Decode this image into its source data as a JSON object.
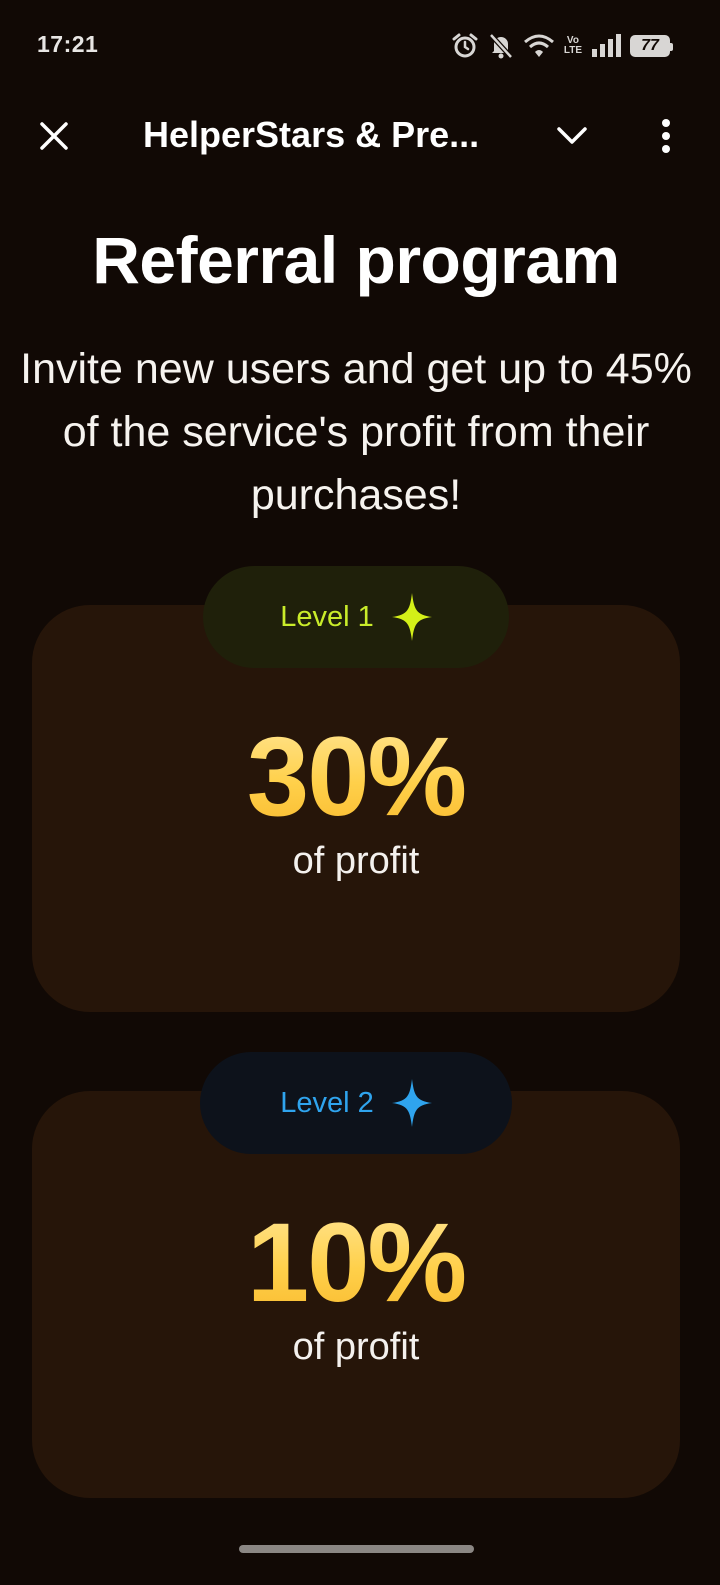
{
  "status_bar": {
    "time": "17:21",
    "battery": "77",
    "volte_top": "Vo",
    "volte_bottom": "LTE",
    "icons": [
      "alarm-icon",
      "mute-icon",
      "wifi-icon",
      "volte-icon",
      "signal-icon",
      "battery-icon"
    ]
  },
  "app_bar": {
    "title": "HelperStars & Pre...",
    "icons": [
      "close-icon",
      "chevron-down-icon",
      "more-vertical-icon"
    ]
  },
  "headline": "Referral program",
  "subtitle": "Invite new users and get up to 45% of the service's profit from their purchases!",
  "levels": [
    {
      "label": "Level 1",
      "percent": "30%",
      "caption": "of profit",
      "accent": "#c9ec2a",
      "icon": "sparkle-icon"
    },
    {
      "label": "Level 2",
      "percent": "10%",
      "caption": "of profit",
      "accent": "#2fa4ee",
      "icon": "sparkle-icon"
    }
  ],
  "colors": {
    "background": "#110905",
    "card": "#261509",
    "percent_gradient_top": "#ffe79a",
    "percent_gradient_bottom": "#f8b82c"
  }
}
